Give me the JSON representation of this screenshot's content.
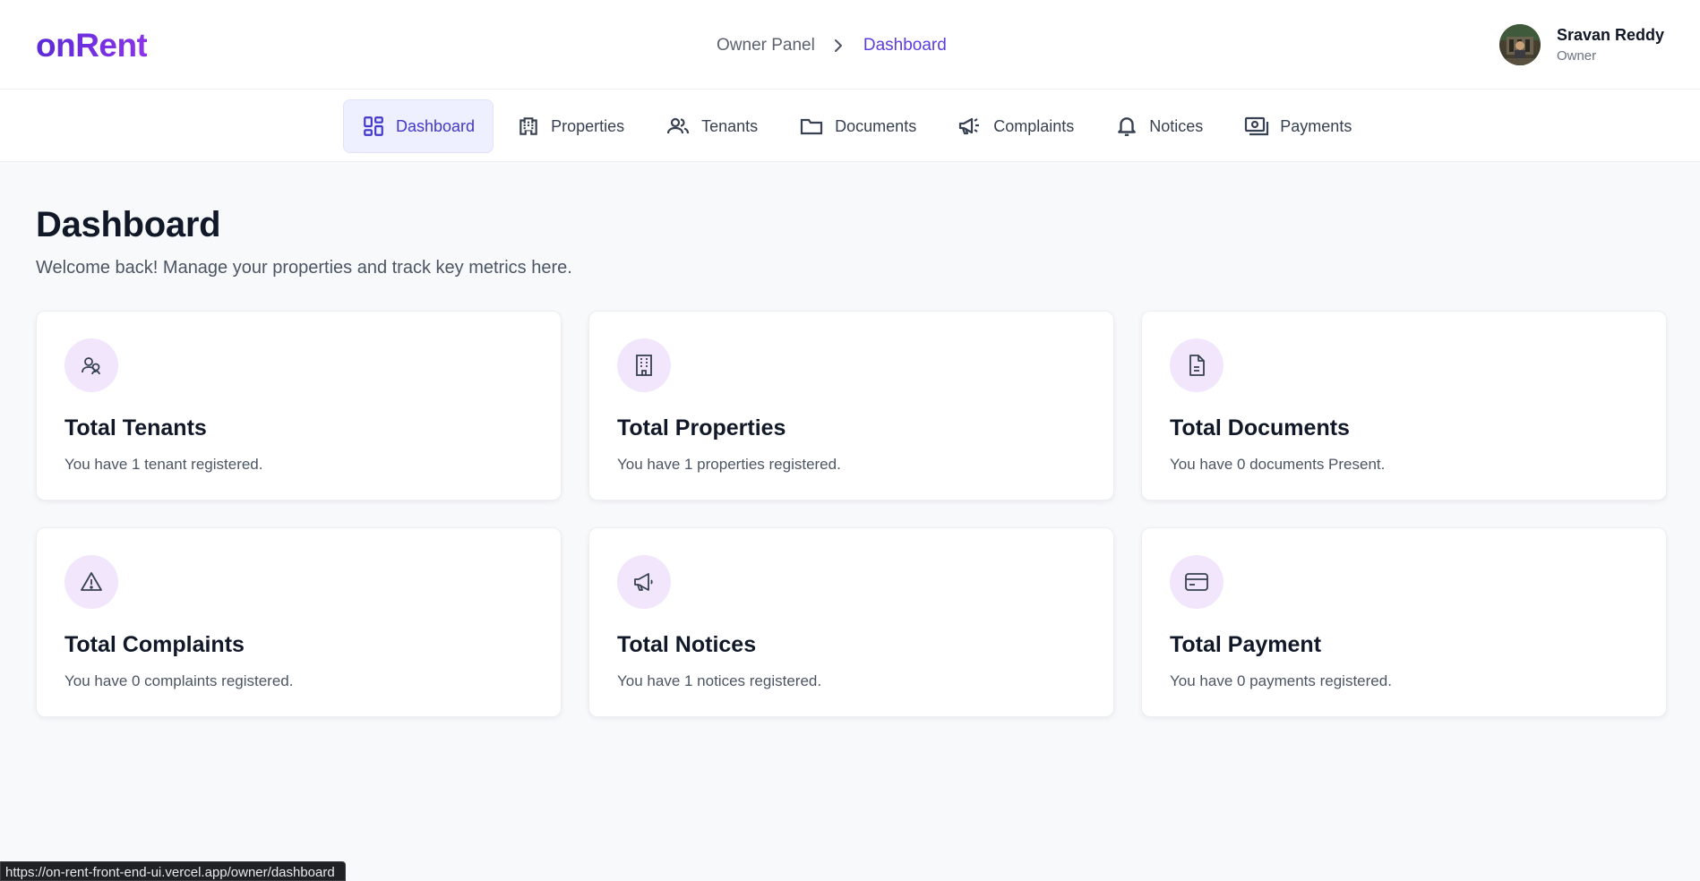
{
  "brand": {
    "logo": "onRent"
  },
  "breadcrumb": {
    "root": "Owner Panel",
    "current": "Dashboard"
  },
  "user": {
    "name": "Sravan Reddy",
    "role": "Owner"
  },
  "nav": [
    {
      "label": "Dashboard",
      "icon": "dashboard-icon",
      "active": true
    },
    {
      "label": "Properties",
      "icon": "building-icon"
    },
    {
      "label": "Tenants",
      "icon": "users-icon"
    },
    {
      "label": "Documents",
      "icon": "folder-icon"
    },
    {
      "label": "Complaints",
      "icon": "megaphone-icon"
    },
    {
      "label": "Notices",
      "icon": "bell-icon"
    },
    {
      "label": "Payments",
      "icon": "cash-icon"
    }
  ],
  "page": {
    "title": "Dashboard",
    "subtitle": "Welcome back! Manage your properties and track key metrics here."
  },
  "cards": [
    {
      "title": "Total Tenants",
      "desc": "You have 1 tenant registered.",
      "icon": "users-icon"
    },
    {
      "title": "Total Properties",
      "desc": "You have 1 properties registered.",
      "icon": "building-icon"
    },
    {
      "title": "Total Documents",
      "desc": "You have 0 documents Present.",
      "icon": "document-icon"
    },
    {
      "title": "Total Complaints",
      "desc": "You have 0 complaints registered.",
      "icon": "warning-icon"
    },
    {
      "title": "Total Notices",
      "desc": "You have 1 notices registered.",
      "icon": "megaphone-icon"
    },
    {
      "title": "Total Payment",
      "desc": "You have 0 payments registered.",
      "icon": "credit-card-icon"
    }
  ],
  "status_bar": {
    "url": "https://on-rent-front-end-ui.vercel.app/owner/dashboard"
  },
  "colors": {
    "accent": "#5b3ddb",
    "icon_bg": "#f1e6fc",
    "active_nav_bg": "#eef0ff"
  }
}
